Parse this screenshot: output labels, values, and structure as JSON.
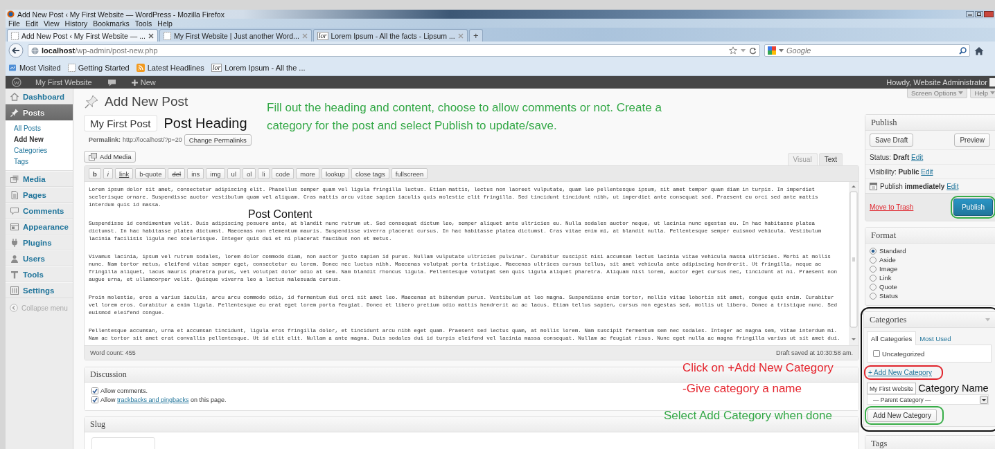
{
  "window": {
    "title": "Add New Post ‹ My First Website — WordPress - Mozilla Firefox"
  },
  "menu_bar": [
    "File",
    "Edit",
    "View",
    "History",
    "Bookmarks",
    "Tools",
    "Help"
  ],
  "tabs": [
    {
      "label": "Add New Post ‹ My First Website — ...",
      "selected": true
    },
    {
      "label": "My First Website | Just another Word...",
      "selected": false
    },
    {
      "label": "Lorem Ipsum - All the facts - Lipsum ...",
      "selected": false,
      "favicon": "lor"
    }
  ],
  "new_tab": "+",
  "address_bar": {
    "host": "localhost",
    "path": "/wp-admin/post-new.php"
  },
  "search": {
    "placeholder": "Google"
  },
  "bookmarks": [
    {
      "label": "Most Visited",
      "kind": "smart"
    },
    {
      "label": "Getting Started",
      "kind": "page"
    },
    {
      "label": "Latest Headlines",
      "kind": "feed"
    },
    {
      "label": "Lorem Ipsum - All the ...",
      "kind": "site",
      "favicon": "lor"
    }
  ],
  "admin_bar": {
    "site": "My First Website",
    "new": "New",
    "greeting": "Howdy, Website Administrator"
  },
  "sidebar": {
    "items": [
      {
        "label": "Dashboard",
        "kind": "dashboard",
        "selected": false
      },
      {
        "label": "Posts",
        "kind": "posts",
        "selected": true,
        "submenu": [
          {
            "label": "All Posts",
            "selected": false
          },
          {
            "label": "Add New",
            "selected": true
          },
          {
            "label": "Categories",
            "selected": false
          },
          {
            "label": "Tags",
            "selected": false
          }
        ]
      },
      {
        "label": "Media",
        "kind": "media",
        "selected": false
      },
      {
        "label": "Pages",
        "kind": "pages",
        "selected": false
      },
      {
        "label": "Comments",
        "kind": "comments",
        "selected": false
      },
      {
        "label": "Appearance",
        "kind": "appearance",
        "selected": false
      },
      {
        "label": "Plugins",
        "kind": "plugins",
        "selected": false
      },
      {
        "label": "Users",
        "kind": "users",
        "selected": false
      },
      {
        "label": "Tools",
        "kind": "tools",
        "selected": false
      },
      {
        "label": "Settings",
        "kind": "settings",
        "selected": false
      }
    ],
    "collapse": "Collapse menu"
  },
  "screen_options": "Screen Options",
  "help": "Help",
  "post": {
    "heading": "Add New Post",
    "title": "My First Post",
    "permalink_label": "Permalink:",
    "permalink": "http://localhost/?p=20",
    "change_permalinks": "Change Permalinks",
    "add_media": "Add Media",
    "editor_tabs": [
      {
        "label": "Visual",
        "selected": false
      },
      {
        "label": "Text",
        "selected": true
      }
    ],
    "toolbar": [
      {
        "label": "b",
        "kind": "bold"
      },
      {
        "label": "i",
        "kind": "italic"
      },
      {
        "label": "link",
        "kind": "link"
      },
      {
        "label": "b-quote",
        "kind": "plain"
      },
      {
        "label": "del",
        "kind": "strike"
      },
      {
        "label": "ins",
        "kind": "plain"
      },
      {
        "label": "img",
        "kind": "plain"
      },
      {
        "label": "ul",
        "kind": "plain"
      },
      {
        "label": "ol",
        "kind": "plain"
      },
      {
        "label": "li",
        "kind": "plain"
      },
      {
        "label": "code",
        "kind": "plain"
      },
      {
        "label": "more",
        "kind": "plain"
      },
      {
        "label": "lookup",
        "kind": "plain"
      },
      {
        "label": "close tags",
        "kind": "plain"
      },
      {
        "label": "fullscreen",
        "kind": "plain"
      }
    ],
    "content": [
      "Lorem ipsum dolor sit amet, consectetur adipiscing elit. Phasellus semper quam vel ligula fringilla luctus. Etiam mattis, lectus non laoreet vulputate, quam leo pellentesque ipsum, sit amet tempor quam diam in turpis. In imperdiet scelerisque ornare. Suspendisse auctor vestibulum quam vel aliquam. Cras mattis arcu vitae sapien iaculis quis molestie elit fringilla. Sed tincidunt tincidunt nibh, ut imperdiet ante consequat sed. Praesent eu orci sed ante mattis interdum quis id massa.",
      "Suspendisse id condimentum velit. Duis adipiscing posuere ante, at blandit nunc rutrum ut. Sed consequat dictum leo, semper aliquet ante ultricies eu. Nulla sodales auctor neque, ut lacinia nunc egestas eu. In hac habitasse platea dictumst. In hac habitasse platea dictumst. Maecenas non elementum mauris. Suspendisse viverra placerat cursus. In hac habitasse platea dictumst. Cras vitae enim mi, at blandit nulla. Pellentesque semper euismod vehicula. Vestibulum lacinia facilisis ligula nec scelerisque. Integer quis dui et mi placerat faucibus non et metus.",
      "Vivamus lacinia, ipsum vel rutrum sodales, lorem dolor commodo diam, non auctor justo sapien id purus. Nullam vulputate ultricies pulvinar. Curabitur suscipit nisi accumsan lectus lacinia vitae vehicula massa ultricies. Morbi at mollis nunc. Nam tortor metus, eleifend vitae semper eget, consectetur eu lorem. Donec nec luctus nibh. Maecenas volutpat porta tristique. Maecenas ultrices cursus tellus, sit amet vehicula ante adipiscing hendrerit. Ut fringilla, neque ac fringilla aliquet, lacus mauris pharetra purus, vel volutpat dolor odio at sem. Nam blandit rhoncus ligula. Pellentesque volutpat sem quis ligula aliquet pharetra. Aliquam nisl lorem, auctor eget cursus nec, tincidunt at mi. Praesent non augue urna, et ullamcorper velit. Quisque viverra leo a lectus malesuada cursus.",
      "Proin molestie, eros a varius iaculis, arcu arcu commodo odio, id fermentum dui orci sit amet leo. Maecenas at bibendum purus. Vestibulum at leo magna. Suspendisse enim tortor, mollis vitae lobortis sit amet, congue quis enim. Curabitur vel lorem eros. Curabitur a enim ligula. Pellentesque eu erat eget lorem porta feugiat. Donec et libero pretium odio mattis hendrerit ac ac lacus. Etiam tellus sapien, cursus non egestas sed, mollis ut libero. Donec a tristique nunc. Sed euismod eleifend congue.",
      "Pellentesque accumsan, urna et accumsan tincidunt, ligula eros fringilla dolor, et tincidunt arcu nibh eget quam. Praesent sed lectus quam, at mollis lorem. Nam suscipit fermentum sem nec sodales. Integer ac magna sem, vitae interdum mi. Nam ac tortor sit amet erat convallis pellentesque. Ut id elit elit. Nullam a ante magna. Duis sodales dui id turpis eleifend vel lacinia massa consequat. Nullam ac feugiat risus. Nunc eget nulla ac magna fringilla varius ut sit amet dui."
    ],
    "word_count": "Word count: 455",
    "draft_saved": "Draft saved at 10:30:58 am."
  },
  "discussion": {
    "title": "Discussion",
    "options": [
      {
        "text": "Allow comments.",
        "checked": true
      },
      {
        "text": "Allow ",
        "link": "trackbacks and pingbacks",
        "text_after": " on this page.",
        "checked": true
      }
    ]
  },
  "slug": {
    "title": "Slug"
  },
  "publish": {
    "title": "Publish",
    "save_draft": "Save Draft",
    "preview": "Preview",
    "rows": [
      {
        "label": "Status:",
        "value": "Draft",
        "action": "Edit",
        "kind": "text"
      },
      {
        "label": "Visibility:",
        "value": "Public",
        "action": "Edit",
        "kind": "text"
      },
      {
        "label": "Publish",
        "value": "immediately",
        "action": "Edit",
        "kind": "schedule"
      }
    ],
    "trash": "Move to Trash",
    "publish_button": "Publish"
  },
  "format": {
    "title": "Format",
    "options": [
      {
        "label": "Standard",
        "selected": true
      },
      {
        "label": "Aside",
        "selected": false
      },
      {
        "label": "Image",
        "selected": false
      },
      {
        "label": "Link",
        "selected": false
      },
      {
        "label": "Quote",
        "selected": false
      },
      {
        "label": "Status",
        "selected": false
      }
    ]
  },
  "categories": {
    "title": "Categories",
    "tabs": [
      {
        "label": "All Categories",
        "selected": true
      },
      {
        "label": "Most Used",
        "selected": false
      }
    ],
    "items": [
      {
        "label": "Uncategorized",
        "checked": false
      }
    ],
    "add_link": "+ Add New Category",
    "new_name": "My First Website",
    "parent": "— Parent Category —",
    "add_button": "Add New Category"
  },
  "tags": {
    "title": "Tags"
  },
  "notes": [
    {
      "text": "Post Heading",
      "color": "#111111",
      "kind": "heading"
    },
    {
      "text": "Fill out the heading and content, choose to allow comments or not. Create a\ncategory for the post and select Publish to update/save.",
      "color": "#33a846",
      "kind": "overlay"
    },
    {
      "text": "Post Content",
      "color": "#111111",
      "kind": "content"
    },
    {
      "text": "Click on +Add New Category",
      "color": "#e5232c",
      "kind": "overlay"
    },
    {
      "text": "-Give category a name",
      "color": "#e5232c",
      "kind": "overlay"
    },
    {
      "text": "Category Name",
      "color": "#111111",
      "kind": "field"
    },
    {
      "text": "Select Add Category when done",
      "color": "#33a846",
      "kind": "overlay"
    }
  ]
}
